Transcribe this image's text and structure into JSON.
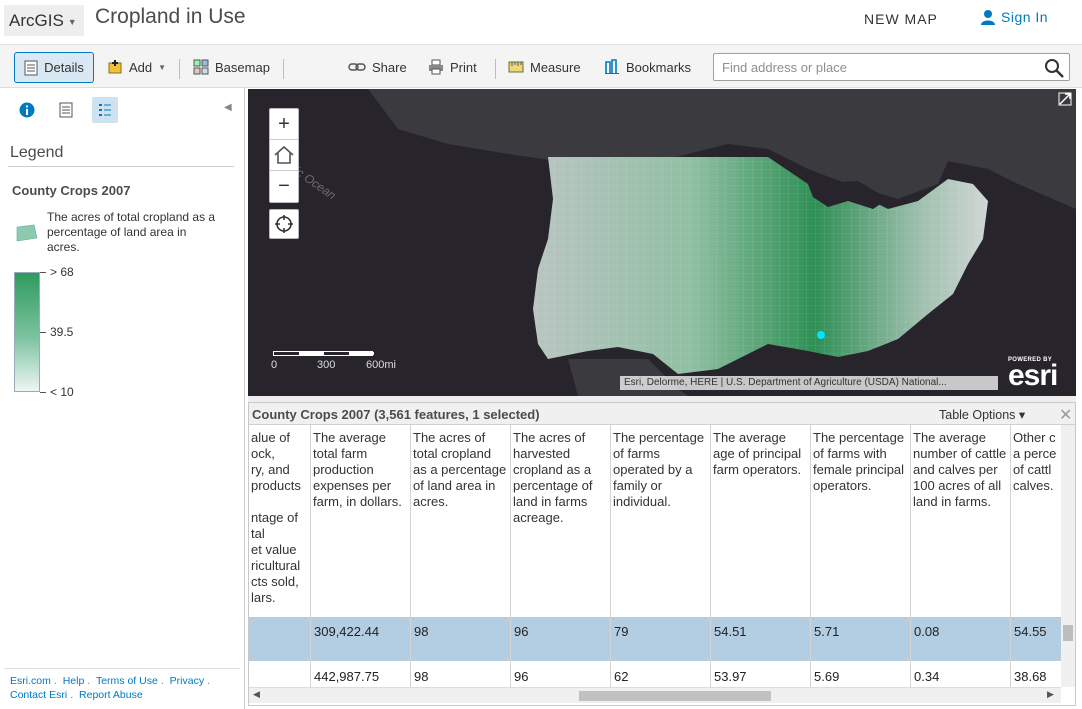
{
  "header": {
    "app_name": "ArcGIS",
    "map_title": "Cropland in Use",
    "new_map": "NEW MAP",
    "sign_in": "Sign In"
  },
  "toolbar": {
    "details": "Details",
    "add": "Add",
    "basemap": "Basemap",
    "share": "Share",
    "print": "Print",
    "measure": "Measure",
    "bookmarks": "Bookmarks",
    "search_placeholder": "Find address or place"
  },
  "sidebar": {
    "legend_heading": "Legend",
    "layer_name": "County Crops 2007",
    "legend_description": "The acres of total cropland as a percentage of land area in acres.",
    "ramp_labels": [
      "> 68",
      "39.5",
      "< 10"
    ],
    "footer_links": [
      "Esri.com",
      "Help",
      "Terms of Use",
      "Privacy",
      "Contact Esri",
      "Report Abuse"
    ]
  },
  "map": {
    "scale_labels": [
      "0",
      "300",
      "600mi"
    ],
    "attribution": "Esri, Delorme, HERE | U.S. Department of Agriculture (USDA) National...",
    "esri_powered_by": "POWERED BY",
    "esri_wordmark": "esri",
    "ocean_label": "Pacific Ocean"
  },
  "table": {
    "title": "County Crops 2007 (3,561 features, 1 selected)",
    "options_label": "Table Options ▾",
    "columns": [
      "alue of\nock,\nry, and\nproducts\n\nntage of\ntal\net value\nricultural\ncts sold,\nlars.",
      "The average total farm production expenses per farm, in dollars.",
      "The acres of total cropland as a percentage of land area in acres.",
      "The acres of harvested cropland as a percentage of land in farms acreage.",
      "The percentage of farms operated by a family or individual.",
      "The average age of principal farm operators.",
      "The percentage of farms with female principal operators.",
      "The average number of cattle and calves per 100 acres of all land in farms.",
      "Other c a perce of cattl calves."
    ],
    "rows": [
      [
        "",
        "309,422.44",
        "98",
        "96",
        "79",
        "54.51",
        "5.71",
        "0.08",
        "54.55"
      ],
      [
        "",
        "442,987.75",
        "98",
        "96",
        "62",
        "53.97",
        "5.69",
        "0.34",
        "38.68"
      ]
    ]
  },
  "colors": {
    "accent": "#0079c1",
    "selected_row": "#b3cde3",
    "map_background": "#27242c",
    "ramp_high": "#2f9a5e",
    "ramp_low": "#eef5f3"
  }
}
